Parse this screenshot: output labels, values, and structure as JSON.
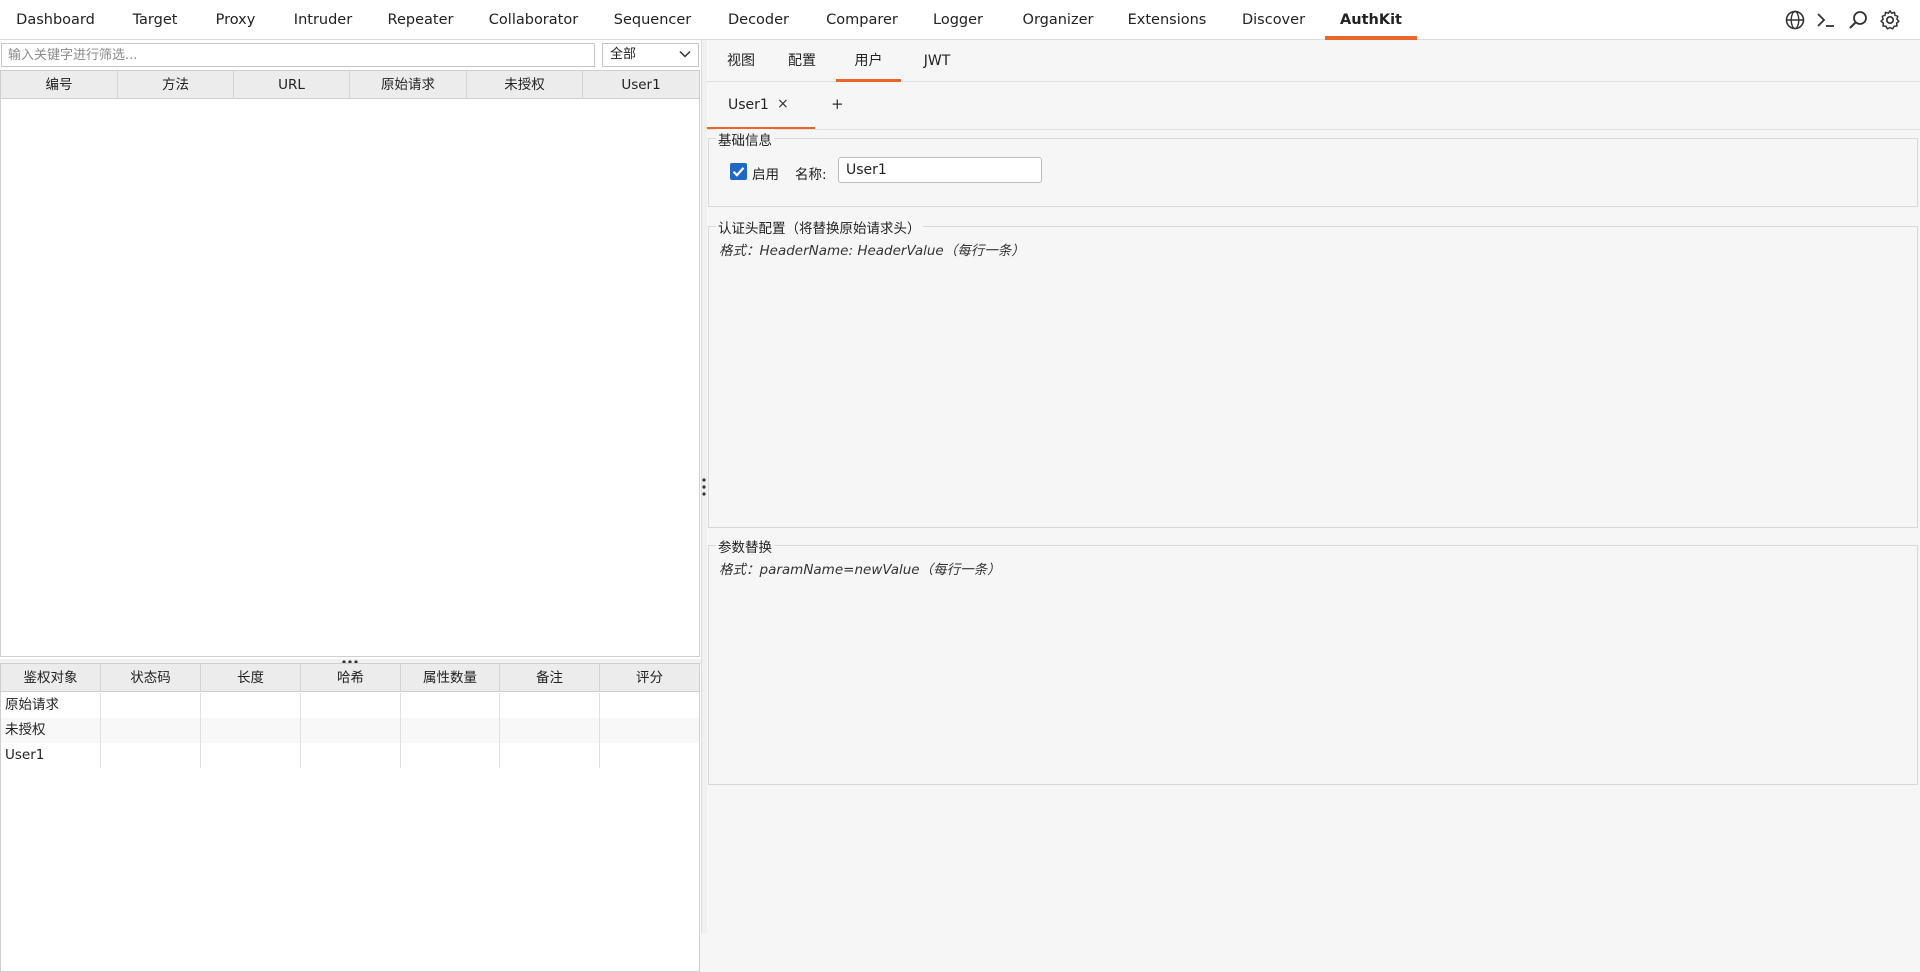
{
  "topnav": {
    "tabs": [
      {
        "label": "Dashboard"
      },
      {
        "label": "Target"
      },
      {
        "label": "Proxy"
      },
      {
        "label": "Intruder"
      },
      {
        "label": "Repeater"
      },
      {
        "label": "Collaborator"
      },
      {
        "label": "Sequencer"
      },
      {
        "label": "Decoder"
      },
      {
        "label": "Comparer"
      },
      {
        "label": "Logger"
      },
      {
        "label": "Organizer"
      },
      {
        "label": "Extensions"
      },
      {
        "label": "Discover"
      },
      {
        "label": "AuthKit"
      }
    ],
    "active_tab": "AuthKit",
    "icons": [
      "globe-icon",
      "terminal-icon",
      "search-icon",
      "settings-icon"
    ]
  },
  "left": {
    "filter": {
      "placeholder": "输入关键字进行筛选...",
      "value": ""
    },
    "filter_select": {
      "value": "全部"
    },
    "request_table": {
      "columns": [
        "编号",
        "方法",
        "URL",
        "原始请求",
        "未授权",
        "User1"
      ],
      "rows": []
    },
    "result_table": {
      "columns": [
        "鉴权对象",
        "状态码",
        "长度",
        "哈希",
        "属性数量",
        "备注",
        "评分"
      ],
      "rows": [
        {
          "target": "原始请求"
        },
        {
          "target": "未授权"
        },
        {
          "target": "User1"
        }
      ]
    }
  },
  "right": {
    "subtabs": [
      {
        "label": "视图"
      },
      {
        "label": "配置"
      },
      {
        "label": "用户"
      },
      {
        "label": "JWT"
      }
    ],
    "active_subtab": "用户",
    "user_tabs": [
      {
        "label": "User1",
        "close": "×"
      }
    ],
    "add_tab": "+",
    "basic": {
      "title": "基础信息",
      "enabled_label": "启用",
      "enabled": true,
      "name_label": "名称:",
      "name_value": "User1"
    },
    "auth_header": {
      "title": "认证头配置（将替换原始请求头）",
      "placeholder": "格式：HeaderName: HeaderValue（每行一条）"
    },
    "param_replace": {
      "title": "参数替换",
      "placeholder": "格式：paramName=newValue（每行一条）"
    }
  }
}
